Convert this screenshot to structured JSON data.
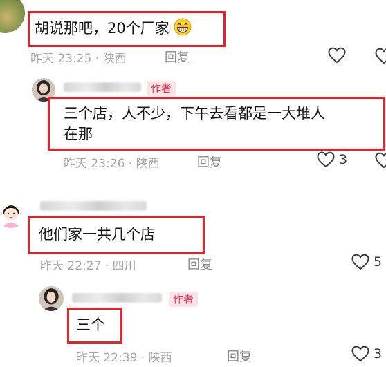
{
  "comments": [
    {
      "text_before_emoji": "胡说那吧，20个厂家",
      "emoji": "grinning-face-emoji",
      "meta": "昨天 23:25 · 陕西",
      "reply_label": "回复",
      "likes": ""
    },
    {
      "author_tag": "作者",
      "text_line1": "三个店，人不少，下午去看都是一大堆人",
      "text_line2": "在那",
      "meta": "昨天 23:26 · 陕西",
      "reply_label": "回复",
      "likes": "3"
    },
    {
      "text": "他们家一共几个店",
      "meta": "昨天 22:27 · 四川",
      "reply_label": "回复",
      "likes": "5"
    },
    {
      "author_tag": "作者",
      "text": "三个",
      "meta": "昨天 22:39 · 陕西",
      "reply_label": "回复",
      "likes": "3"
    }
  ],
  "colors": {
    "highlight_box": "#e8202a",
    "author_tag_text": "#ff2d55",
    "author_tag_bg": "#fde4e6",
    "meta_text": "#a8a8a8"
  },
  "icons": [
    "heart-outline-icon"
  ]
}
